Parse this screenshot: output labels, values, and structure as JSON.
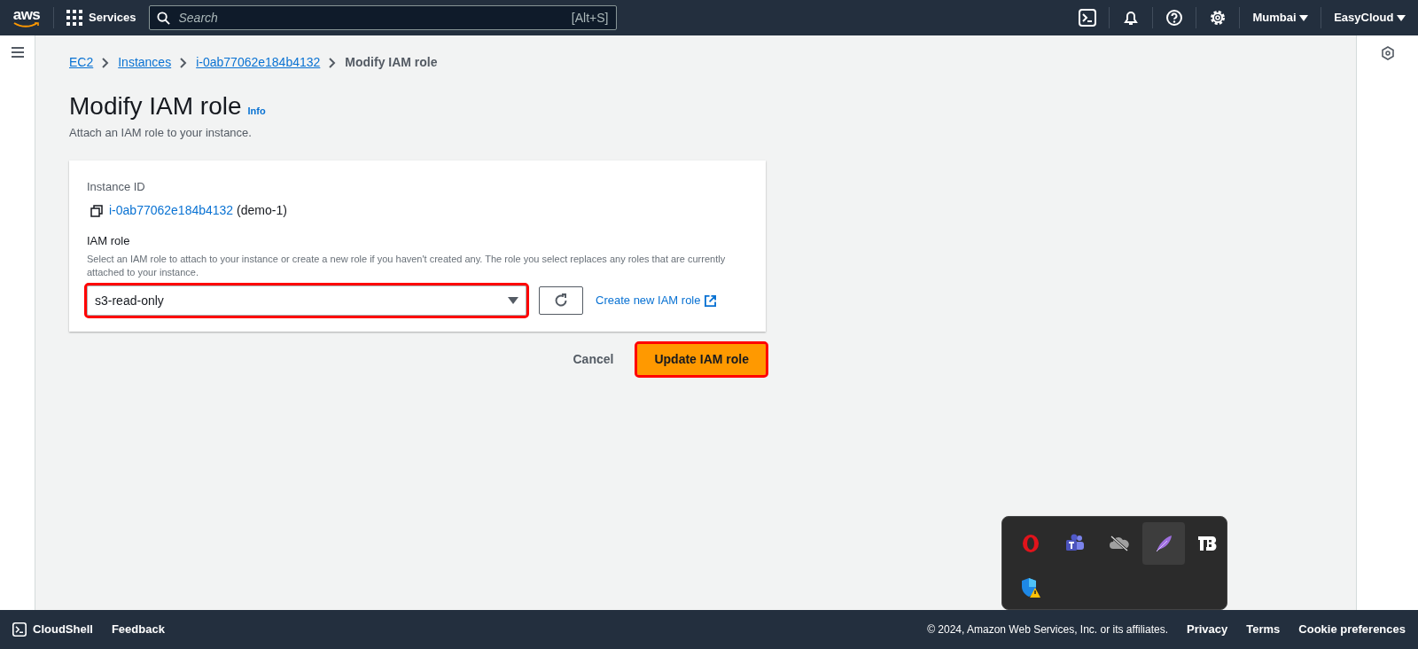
{
  "top_nav": {
    "logo": "aws",
    "services": "Services",
    "search": {
      "placeholder": "Search",
      "shortcut": "[Alt+S]"
    },
    "region": "Mumbai",
    "account": "EasyCloud"
  },
  "breadcrumbs": [
    {
      "label": "EC2",
      "link": true
    },
    {
      "label": "Instances",
      "link": true
    },
    {
      "label": "i-0ab77062e184b4132",
      "link": true
    },
    {
      "label": "Modify IAM role",
      "link": false
    }
  ],
  "page": {
    "title": "Modify IAM role",
    "info": "Info",
    "description": "Attach an IAM role to your instance."
  },
  "form": {
    "instance_label": "Instance ID",
    "instance_id": "i-0ab77062e184b4132",
    "instance_name": "(demo-1)",
    "role_label": "IAM role",
    "role_help": "Select an IAM role to attach to your instance or create a new role if you haven't created any. The role you select replaces any roles that are currently attached to your instance.",
    "role_value": "s3-read-only",
    "create_link": "Create new IAM role",
    "highlighted": true
  },
  "actions": {
    "cancel": "Cancel",
    "submit": "Update IAM role",
    "highlighted": true
  },
  "footer": {
    "cloudshell": "CloudShell",
    "feedback": "Feedback",
    "copyright": "© 2024, Amazon Web Services, Inc. or its affiliates.",
    "links": [
      "Privacy",
      "Terms",
      "Cookie preferences"
    ]
  },
  "tray": [
    {
      "kind": "opera",
      "highlighted": false
    },
    {
      "kind": "teams",
      "highlighted": false
    },
    {
      "kind": "cloud",
      "highlighted": false
    },
    {
      "kind": "feather",
      "highlighted": true
    },
    {
      "kind": "tb",
      "highlighted": false
    },
    {
      "kind": "shield",
      "highlighted": false
    }
  ]
}
